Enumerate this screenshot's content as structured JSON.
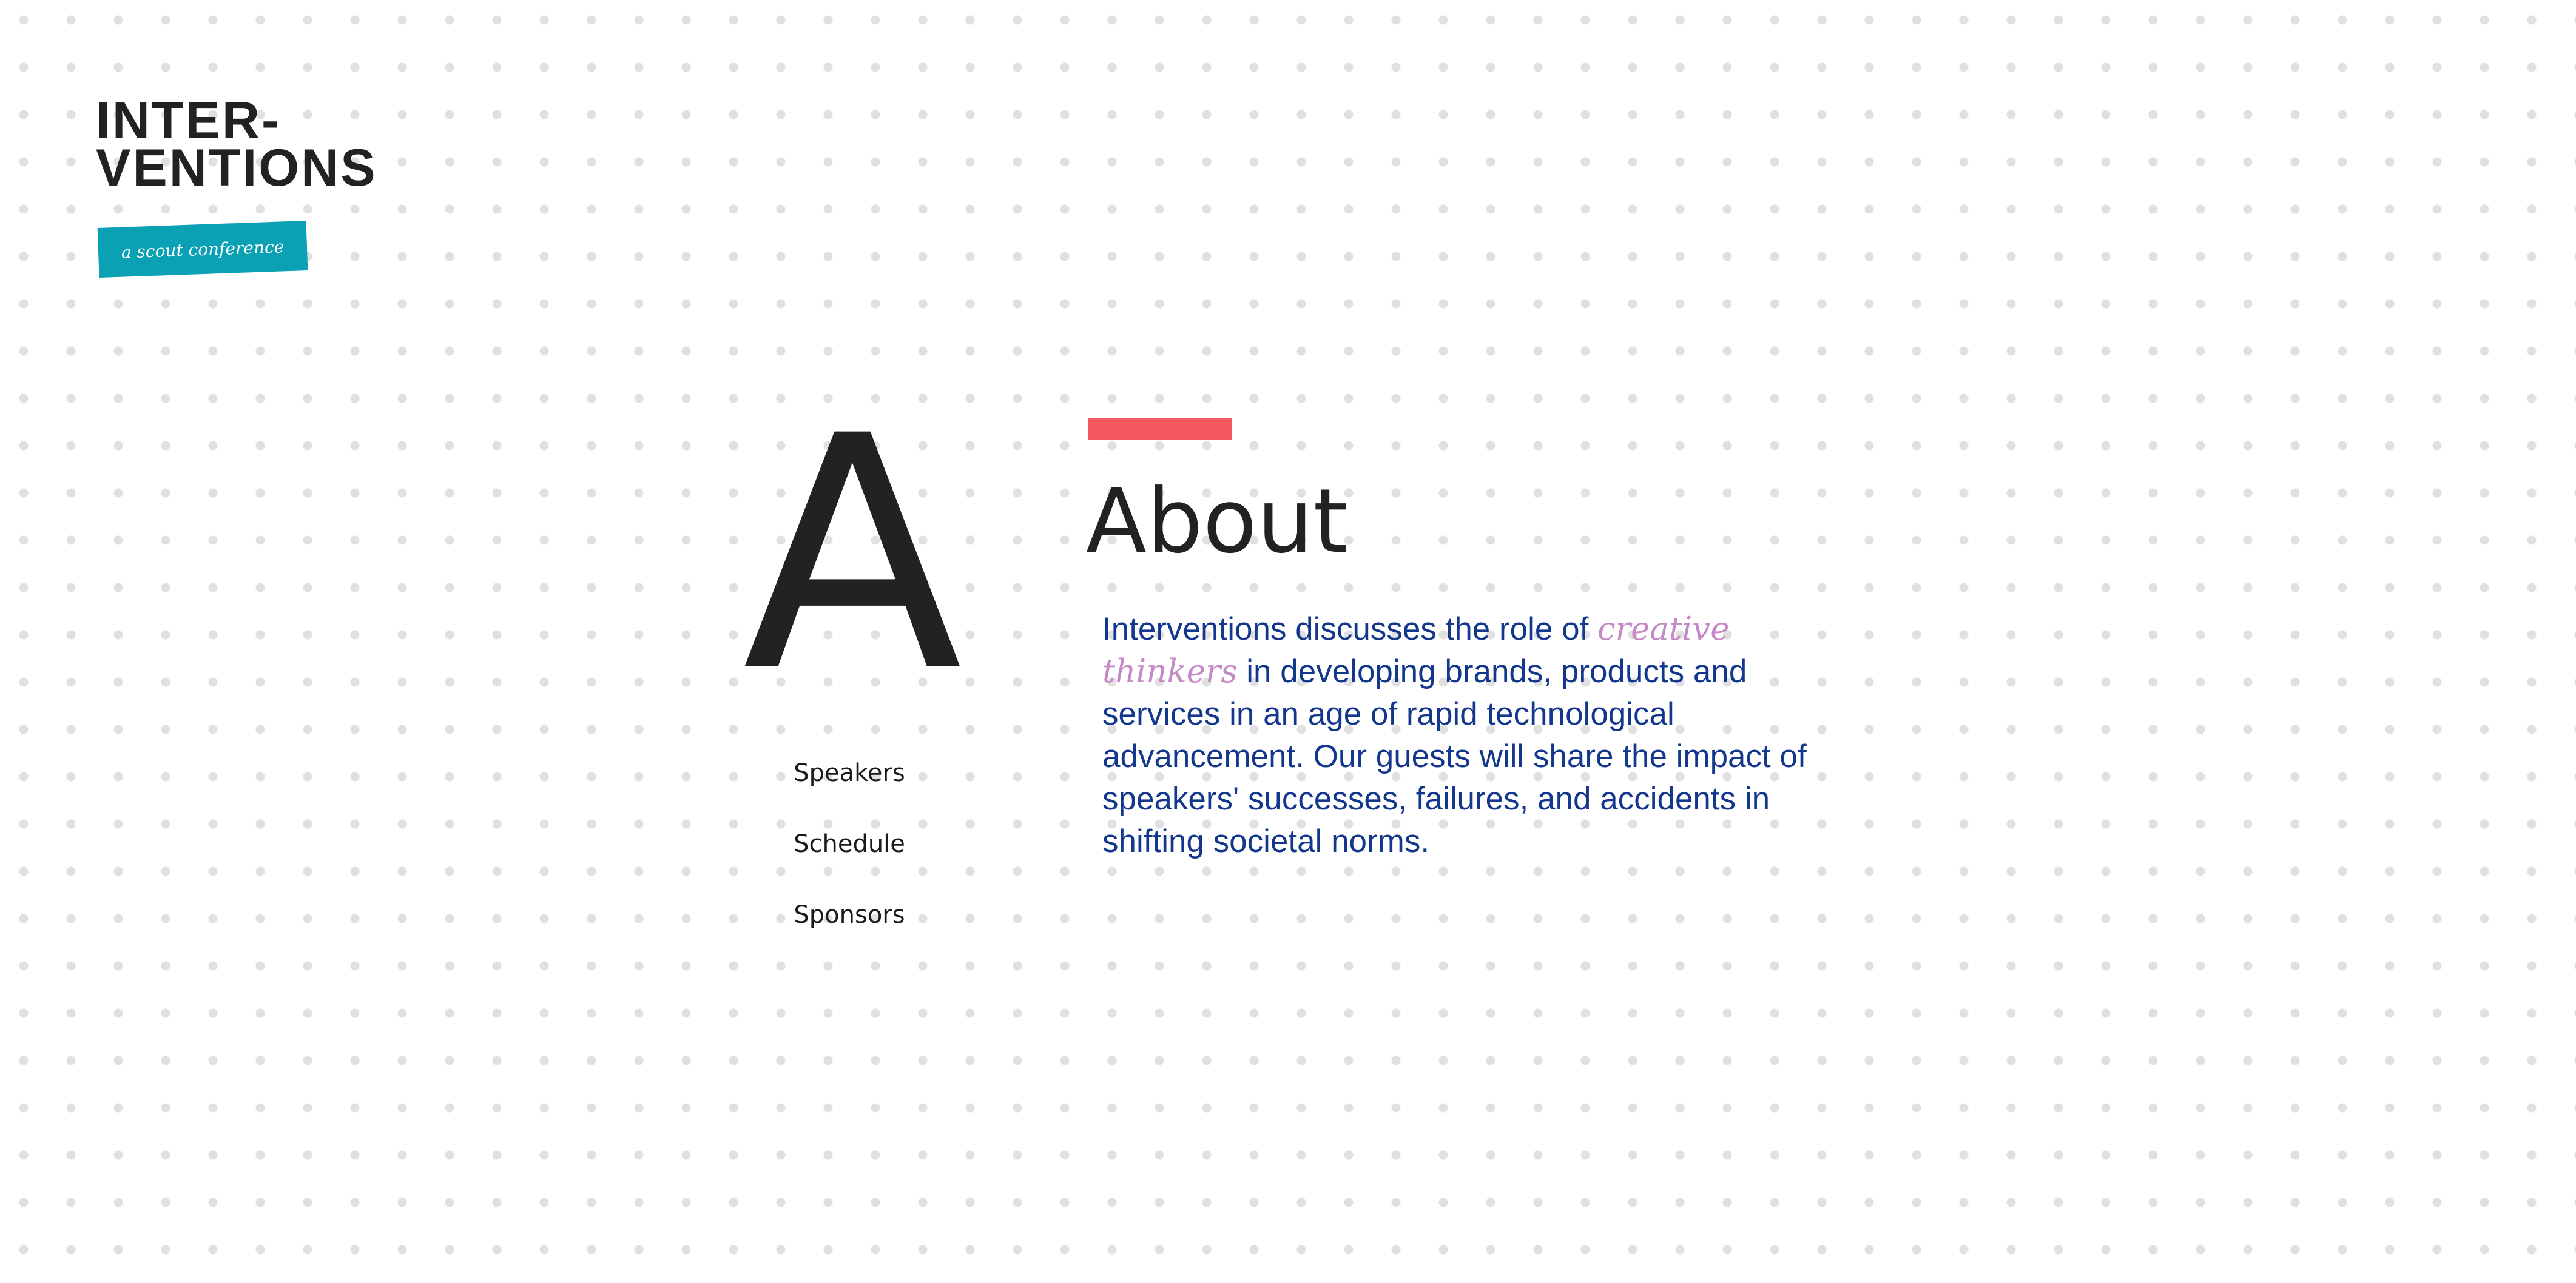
{
  "logo": {
    "line1": "INTER-",
    "line2": "VENTIONS",
    "tagline": "a scout conference",
    "tag_color": "#0aa1b5"
  },
  "hero": {
    "letter": "A"
  },
  "nav": {
    "items": [
      {
        "label": "Speakers"
      },
      {
        "label": "Schedule"
      },
      {
        "label": "Sponsors"
      }
    ]
  },
  "about": {
    "accent_color": "#f4575f",
    "title": "About",
    "text_before": "Interventions discusses the role of ",
    "emphasis": "creative thinkers",
    "text_after": " in developing brands, products and services in an age of rapid technological advancement. Our guests will share the impact of speakers' successes, failures, and accidents in shifting societal norms.",
    "text_color": "#13378c",
    "emphasis_color": "#c58ac5"
  }
}
